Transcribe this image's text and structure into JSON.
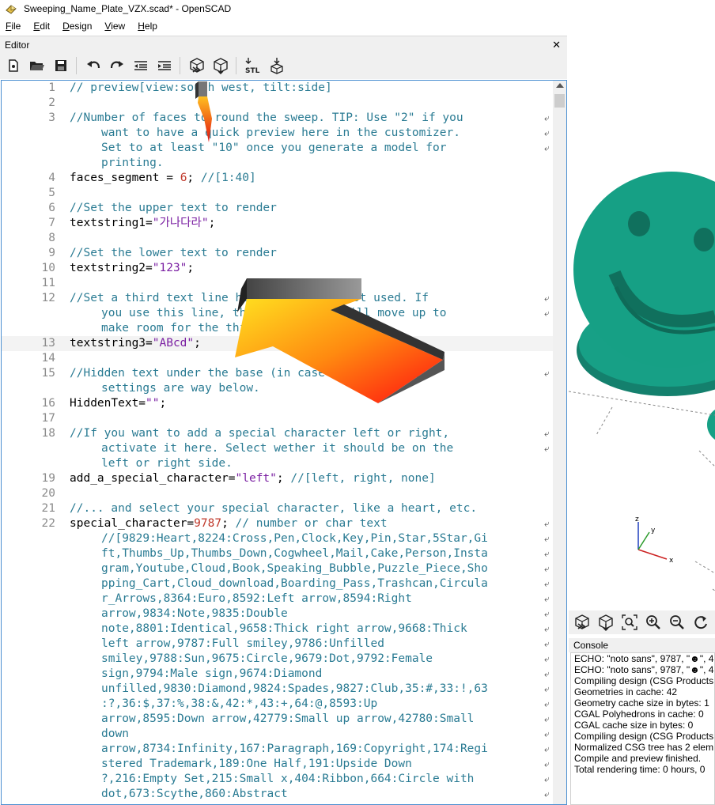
{
  "window": {
    "title": "Sweeping_Name_Plate_VZX.scad* - OpenSCAD"
  },
  "menu": [
    {
      "u": "F",
      "rest": "ile"
    },
    {
      "u": "E",
      "rest": "dit"
    },
    {
      "u": "D",
      "rest": "esign"
    },
    {
      "u": "V",
      "rest": "iew"
    },
    {
      "u": "H",
      "rest": "elp"
    }
  ],
  "editor": {
    "panel_title": "Editor",
    "close": "✕",
    "toolbar": [
      "new-file-icon",
      "open-file-icon",
      "save-icon",
      "undo-icon",
      "redo-icon",
      "unindent-icon",
      "indent-icon",
      "preview-icon",
      "render-icon",
      "export-stl-icon",
      "send-to-print-icon"
    ]
  },
  "code": [
    {
      "n": "1",
      "segs": [
        [
          "c",
          "// preview[view:south west, tilt:side]"
        ]
      ]
    },
    {
      "n": "2",
      "segs": []
    },
    {
      "n": "3",
      "segs": [
        [
          "c",
          "//Number of faces to round the sweep. TIP: Use \"2\" if you"
        ]
      ],
      "wrap": true
    },
    {
      "n": "",
      "cont": true,
      "segs": [
        [
          "c",
          "want to have a quick preview here in the customizer."
        ]
      ],
      "wrap": true
    },
    {
      "n": "",
      "cont": true,
      "segs": [
        [
          "c",
          "Set to at least \"10\" once you generate a model for"
        ]
      ],
      "wrap": true
    },
    {
      "n": "",
      "cont": true,
      "segs": [
        [
          "c",
          "printing."
        ]
      ]
    },
    {
      "n": "4",
      "segs": [
        [
          "d",
          "faces_segment = "
        ],
        [
          "n",
          "6"
        ],
        [
          "d",
          "; "
        ],
        [
          "c",
          "//[1:40]"
        ]
      ]
    },
    {
      "n": "5",
      "segs": []
    },
    {
      "n": "6",
      "segs": [
        [
          "c",
          "//Set the upper text to render"
        ]
      ]
    },
    {
      "n": "7",
      "segs": [
        [
          "d",
          "textstring1="
        ],
        [
          "s",
          "\"가나다라\""
        ],
        [
          "d",
          ";"
        ]
      ]
    },
    {
      "n": "8",
      "segs": []
    },
    {
      "n": "9",
      "segs": [
        [
          "c",
          "//Set the lower text to render"
        ]
      ]
    },
    {
      "n": "10",
      "segs": [
        [
          "d",
          "textstring2="
        ],
        [
          "s",
          "\"123\""
        ],
        [
          "d",
          ";"
        ]
      ]
    },
    {
      "n": "11",
      "segs": []
    },
    {
      "n": "12",
      "segs": [
        [
          "c",
          "//Set a third text line here. Typically not used. If"
        ]
      ],
      "wrap": true
    },
    {
      "n": "",
      "cont": true,
      "segs": [
        [
          "c",
          "you use this line, the other lines will move up to"
        ]
      ],
      "wrap": true
    },
    {
      "n": "",
      "cont": true,
      "segs": [
        [
          "c",
          "make room for the third line."
        ]
      ]
    },
    {
      "n": "13",
      "hl": true,
      "segs": [
        [
          "d",
          "textstring3="
        ],
        [
          "s",
          "\"ABcd\""
        ],
        [
          "d",
          ";"
        ]
      ]
    },
    {
      "n": "14",
      "segs": []
    },
    {
      "n": "15",
      "segs": [
        [
          "c",
          "//Hidden text under the base (in case you print it),"
        ]
      ],
      "wrap": true
    },
    {
      "n": "",
      "cont": true,
      "segs": [
        [
          "c",
          "settings are way below."
        ]
      ]
    },
    {
      "n": "16",
      "segs": [
        [
          "d",
          "HiddenText="
        ],
        [
          "s",
          "\"\""
        ],
        [
          "d",
          ";"
        ]
      ]
    },
    {
      "n": "17",
      "segs": []
    },
    {
      "n": "18",
      "segs": [
        [
          "c",
          "//If you want to add a special character left or right,"
        ]
      ],
      "wrap": true
    },
    {
      "n": "",
      "cont": true,
      "segs": [
        [
          "c",
          "activate it here. Select wether it should be on the"
        ]
      ],
      "wrap": true
    },
    {
      "n": "",
      "cont": true,
      "segs": [
        [
          "c",
          "left or right side."
        ]
      ]
    },
    {
      "n": "19",
      "segs": [
        [
          "d",
          "add_a_special_character="
        ],
        [
          "s",
          "\"left\""
        ],
        [
          "d",
          "; "
        ],
        [
          "c",
          "//[left, right, none]"
        ]
      ]
    },
    {
      "n": "20",
      "segs": []
    },
    {
      "n": "21",
      "segs": [
        [
          "c",
          "//... and select your special character, like a heart, etc."
        ]
      ]
    },
    {
      "n": "22",
      "segs": [
        [
          "d",
          "special_character="
        ],
        [
          "n",
          "9787"
        ],
        [
          "d",
          "; "
        ],
        [
          "c",
          "// number or char text"
        ]
      ],
      "wrap": true
    },
    {
      "n": "",
      "cont": true,
      "segs": [
        [
          "c",
          "//[9829:Heart,8224:Cross,Pen,Clock,Key,Pin,Star,5Star,Gi"
        ]
      ],
      "wrap": true
    },
    {
      "n": "",
      "cont": true,
      "segs": [
        [
          "c",
          "ft,Thumbs_Up,Thumbs_Down,Cogwheel,Mail,Cake,Person,Insta"
        ]
      ],
      "wrap": true
    },
    {
      "n": "",
      "cont": true,
      "segs": [
        [
          "c",
          "gram,Youtube,Cloud,Book,Speaking_Bubble,Puzzle_Piece,Sho"
        ]
      ],
      "wrap": true
    },
    {
      "n": "",
      "cont": true,
      "segs": [
        [
          "c",
          "pping_Cart,Cloud_download,Boarding_Pass,Trashcan,Circula"
        ]
      ],
      "wrap": true
    },
    {
      "n": "",
      "cont": true,
      "segs": [
        [
          "c",
          "r_Arrows,8364:Euro,8592:Left arrow,8594:Right"
        ]
      ],
      "wrap": true
    },
    {
      "n": "",
      "cont": true,
      "segs": [
        [
          "c",
          "arrow,9834:Note,9835:Double"
        ]
      ],
      "wrap": true
    },
    {
      "n": "",
      "cont": true,
      "segs": [
        [
          "c",
          "note,8801:Identical,9658:Thick right arrow,9668:Thick"
        ]
      ],
      "wrap": true
    },
    {
      "n": "",
      "cont": true,
      "segs": [
        [
          "c",
          "left arrow,9787:Full smiley,9786:Unfilled"
        ]
      ],
      "wrap": true
    },
    {
      "n": "",
      "cont": true,
      "segs": [
        [
          "c",
          "smiley,9788:Sun,9675:Circle,9679:Dot,9792:Female"
        ]
      ],
      "wrap": true
    },
    {
      "n": "",
      "cont": true,
      "segs": [
        [
          "c",
          "sign,9794:Male sign,9674:Diamond"
        ]
      ],
      "wrap": true
    },
    {
      "n": "",
      "cont": true,
      "segs": [
        [
          "c",
          "unfilled,9830:Diamond,9824:Spades,9827:Club,35:#,33:!,63"
        ]
      ],
      "wrap": true
    },
    {
      "n": "",
      "cont": true,
      "segs": [
        [
          "c",
          ":?,36:$,37:%,38:&,42:*,43:+,64:@,8593:Up"
        ]
      ],
      "wrap": true
    },
    {
      "n": "",
      "cont": true,
      "segs": [
        [
          "c",
          "arrow,8595:Down arrow,42779:Small up arrow,42780:Small"
        ]
      ],
      "wrap": true
    },
    {
      "n": "",
      "cont": true,
      "segs": [
        [
          "c",
          "down"
        ]
      ],
      "wrap": true
    },
    {
      "n": "",
      "cont": true,
      "segs": [
        [
          "c",
          "arrow,8734:Infinity,167:Paragraph,169:Copyright,174:Regi"
        ]
      ],
      "wrap": true
    },
    {
      "n": "",
      "cont": true,
      "segs": [
        [
          "c",
          "stered Trademark,189:One Half,191:Upside Down"
        ]
      ],
      "wrap": true
    },
    {
      "n": "",
      "cont": true,
      "segs": [
        [
          "c",
          "?,216:Empty Set,215:Small x,404:Ribbon,664:Circle with"
        ]
      ],
      "wrap": true
    },
    {
      "n": "",
      "cont": true,
      "segs": [
        [
          "c",
          "dot,673:Scythe,860:Abstract"
        ]
      ],
      "wrap": true
    }
  ],
  "viewport": {
    "axes": {
      "x": "x",
      "y": "y",
      "z": "z"
    },
    "model_color": "#16a085"
  },
  "view_toolbar": [
    "preview-icon",
    "render-icon",
    "zoom-all-icon",
    "zoom-in-icon",
    "zoom-out-icon",
    "reset-view-icon"
  ],
  "console": {
    "title": "Console",
    "lines": [
      "ECHO: \"noto sans\", 9787, \"☻\", 4",
      "ECHO: \"noto sans\", 9787, \"☻\", 4",
      "Compiling design (CSG Products",
      "Geometries in cache: 42",
      "Geometry cache size in bytes: 1",
      "CGAL Polyhedrons in cache: 0",
      "CGAL cache size in bytes: 0",
      "Compiling design (CSG Products",
      "Normalized CSG tree has 2 elem",
      "Compile and preview finished.",
      "Total rendering time: 0 hours, 0"
    ]
  }
}
